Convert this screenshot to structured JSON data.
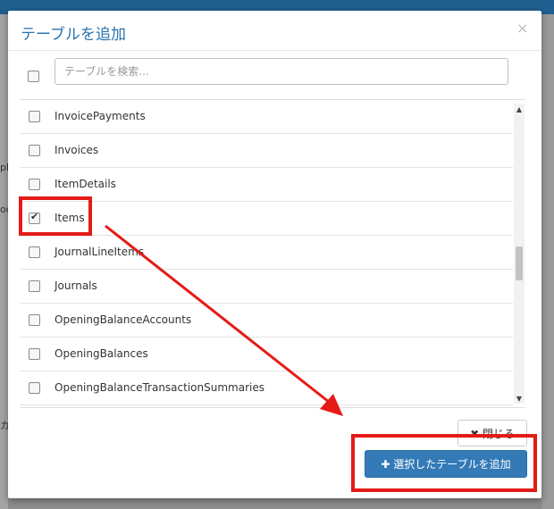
{
  "dialog": {
    "title": "テーブルを追加",
    "close_symbol": "×",
    "search_placeholder": "テーブルを検索...",
    "tables": [
      {
        "name": "InvoicePayments",
        "checked": false
      },
      {
        "name": "Invoices",
        "checked": false
      },
      {
        "name": "ItemDetails",
        "checked": false
      },
      {
        "name": "Items",
        "checked": true
      },
      {
        "name": "JournalLineItems",
        "checked": false
      },
      {
        "name": "Journals",
        "checked": false
      },
      {
        "name": "OpeningBalanceAccounts",
        "checked": false
      },
      {
        "name": "OpeningBalances",
        "checked": false
      },
      {
        "name": "OpeningBalanceTransactionSummaries",
        "checked": false
      }
    ],
    "close_button": "✖ 閉じる",
    "add_button": "✚ 選択したテーブルを追加"
  },
  "background": {
    "fragment_1": "ph",
    "fragment_2": "oc",
    "fragment_3": "カ"
  },
  "annotation": {
    "color": "#e41b17"
  }
}
